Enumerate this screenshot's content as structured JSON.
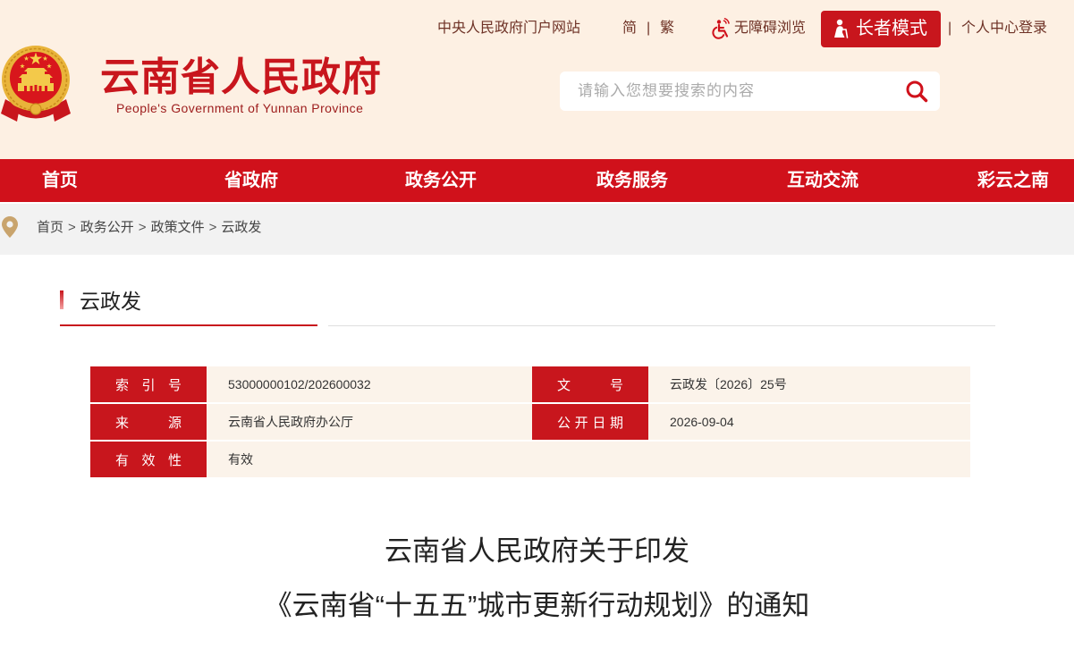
{
  "header": {
    "title": "云南省人民政府",
    "subtitle": "People's Government of Yunnan Province",
    "top_links": {
      "central_gov": "中央人民政府门户网站",
      "simplified": "简",
      "traditional": "繁",
      "separator": "|",
      "accessibility": "无障碍浏览",
      "elder_mode": "长者模式",
      "login": "个人中心登录"
    },
    "search": {
      "placeholder": "请输入您想要搜索的内容"
    }
  },
  "nav": [
    {
      "label": "首页"
    },
    {
      "label": "省政府"
    },
    {
      "label": "政务公开"
    },
    {
      "label": "政务服务"
    },
    {
      "label": "互动交流"
    },
    {
      "label": "彩云之南"
    }
  ],
  "breadcrumb": {
    "items": [
      "首页",
      "政务公开",
      "政策文件",
      "云政发"
    ],
    "separator": ">"
  },
  "section": {
    "title": "云政发"
  },
  "info_table": {
    "index": {
      "label": "索 引 号",
      "value": "53000000102/202600032"
    },
    "doc_number": {
      "label": "文 号",
      "value": "云政发〔2026〕25号"
    },
    "source": {
      "label": "来 源",
      "value": "云南省人民政府办公厅"
    },
    "publish_date": {
      "label": "公开日期",
      "value": "2026-09-04"
    },
    "validity": {
      "label": "有 效 性",
      "value": "有效"
    }
  },
  "document": {
    "title_line1": "云南省人民政府关于印发",
    "title_line2": "《云南省“十五五”城市更新行动规划》的通知"
  },
  "icons": {
    "emblem": "national-emblem-icon",
    "accessibility": "wheelchair-icon",
    "elder_mode": "elder-person-icon",
    "search": "search-icon",
    "breadcrumb": "location-pin-icon"
  },
  "colors": {
    "brand_red": "#d0111b",
    "label_red": "#c8161d",
    "header_bg": "#fdf0e3",
    "breadcrumb_bg": "#f2f2f2",
    "info_value_bg": "#fbf3ea",
    "pin_gold": "#c9a46d"
  }
}
